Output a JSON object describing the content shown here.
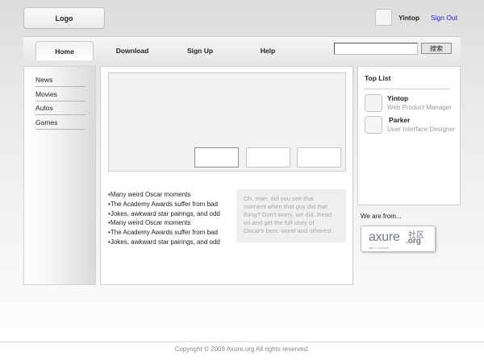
{
  "header": {
    "logo": "Logo",
    "user_name": "Yintop",
    "sign_out": "Sign  Out"
  },
  "nav": {
    "tabs": [
      "Home",
      "Download",
      "Sign  Up",
      "Help"
    ],
    "active_tab": "Home",
    "search_placeholder": "",
    "search_button": "搜索"
  },
  "sidebar": {
    "items": [
      "News",
      "Movies",
      "Autos",
      "Games"
    ]
  },
  "main": {
    "news": [
      "Many weird Oscar moments",
      "The Academy Awards suffer from bad",
      "Jokes, awkward star pairings, and odd",
      "Many weird Oscar moments",
      "The Academy Awards suffer from bad",
      "Jokes, awkward star pairings, and odd"
    ],
    "quote_lines": [
      "Oh, man, did you see that",
      "moment when that guy did that",
      "thing? Don't worry, we did. Read",
      "on and get the full story of",
      "Oscar's best, worst and otherest."
    ]
  },
  "right": {
    "top_list_title": "Top List",
    "users": [
      {
        "name": "Yintop",
        "role": "Web Product Manager"
      },
      {
        "name": "Parker",
        "role": "User Interface Designer"
      }
    ],
    "we_are_from": "We are from...",
    "badge": {
      "word": "axure",
      "cn": "社区",
      "org": ".org",
      "tagline": "SEE IT HAPPEN"
    }
  },
  "footer": {
    "copyright": "Copyright © 2009 Axure.org All rights reserved."
  },
  "colors": {
    "link": "#1a23d4",
    "muted_text": "#9a9a9a",
    "panel_border": "#d0d0d0"
  }
}
